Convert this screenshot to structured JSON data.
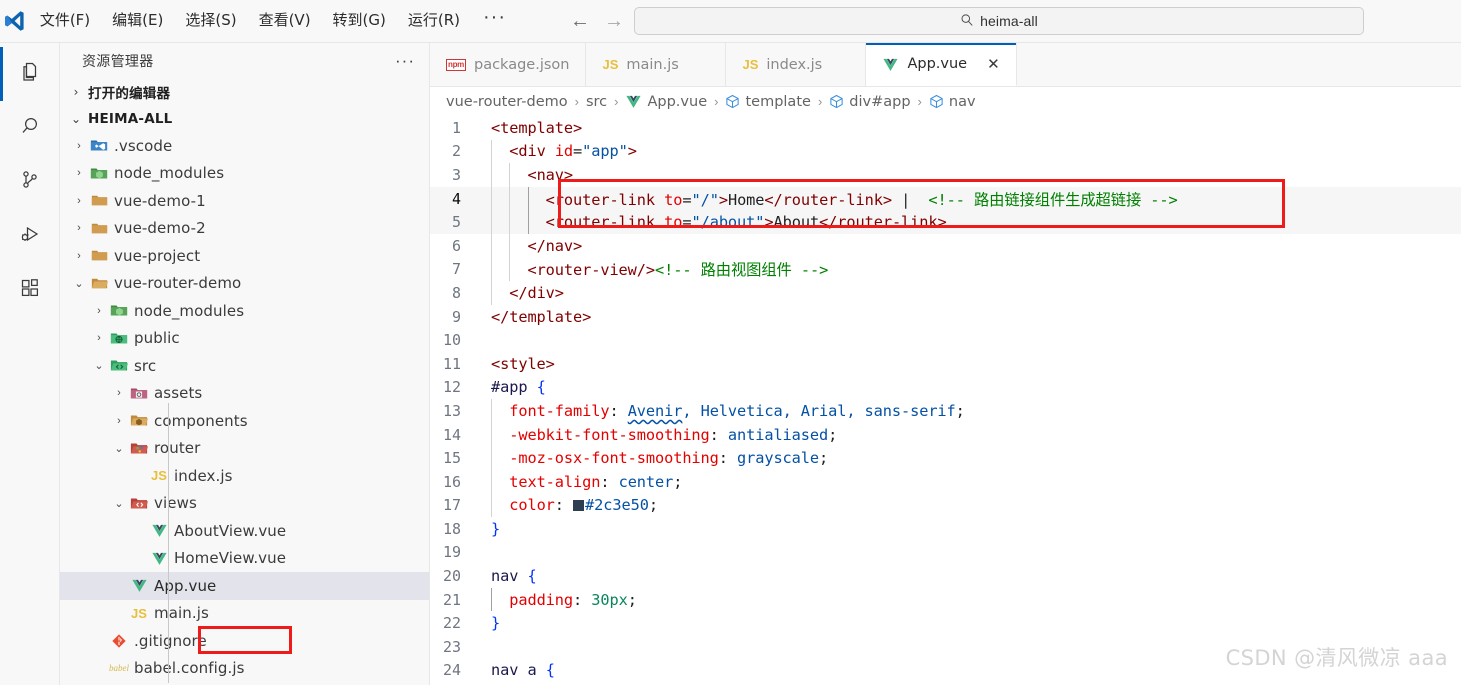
{
  "titlebar": {
    "logo_icon": "vscode-logo-icon",
    "menu": [
      {
        "label": "文件(F)"
      },
      {
        "label": "编辑(E)"
      },
      {
        "label": "选择(S)"
      },
      {
        "label": "查看(V)"
      },
      {
        "label": "转到(G)"
      },
      {
        "label": "运行(R)"
      }
    ],
    "more_label": "···",
    "back_label": "←",
    "forward_label": "→",
    "quick_open": {
      "value": "heima-all",
      "placeholder": "heima-all",
      "icon": "search-icon"
    }
  },
  "activitybar": {
    "items": [
      {
        "name": "explorer",
        "icon": "files-icon",
        "active": true
      },
      {
        "name": "search",
        "icon": "search-icon",
        "active": false
      },
      {
        "name": "source-control",
        "icon": "source-control-icon",
        "active": false
      },
      {
        "name": "run-debug",
        "icon": "run-and-debug-icon",
        "active": false
      },
      {
        "name": "extensions",
        "icon": "extensions-icon",
        "active": false
      }
    ],
    "active_indicator_color": "#005fb8"
  },
  "sidebar": {
    "title": "资源管理器",
    "more_label": "···",
    "sections": [
      {
        "label": "打开的编辑器",
        "expanded": false,
        "twisty": "›"
      },
      {
        "label": "HEIMA-ALL",
        "expanded": true,
        "twisty": "⌄"
      }
    ],
    "tree": [
      {
        "label": ".vscode",
        "depth": 1,
        "twisty": "›",
        "icon": "vscode-folder-icon",
        "selected": false
      },
      {
        "label": "node_modules",
        "depth": 1,
        "twisty": "›",
        "icon": "node-folder-icon",
        "selected": false
      },
      {
        "label": "vue-demo-1",
        "depth": 1,
        "twisty": "›",
        "icon": "folder-icon",
        "selected": false
      },
      {
        "label": "vue-demo-2",
        "depth": 1,
        "twisty": "›",
        "icon": "folder-icon",
        "selected": false
      },
      {
        "label": "vue-project",
        "depth": 1,
        "twisty": "›",
        "icon": "folder-icon",
        "selected": false
      },
      {
        "label": "vue-router-demo",
        "depth": 1,
        "twisty": "⌄",
        "icon": "folder-open-icon",
        "selected": false
      },
      {
        "label": "node_modules",
        "depth": 2,
        "twisty": "›",
        "icon": "node-folder-icon",
        "selected": false
      },
      {
        "label": "public",
        "depth": 2,
        "twisty": "›",
        "icon": "public-folder-icon",
        "selected": false
      },
      {
        "label": "src",
        "depth": 2,
        "twisty": "⌄",
        "icon": "src-folder-icon",
        "selected": false
      },
      {
        "label": "assets",
        "depth": 3,
        "twisty": "›",
        "icon": "assets-folder-icon",
        "selected": false
      },
      {
        "label": "components",
        "depth": 3,
        "twisty": "›",
        "icon": "components-folder-icon",
        "selected": false
      },
      {
        "label": "router",
        "depth": 3,
        "twisty": "⌄",
        "icon": "router-folder-icon",
        "selected": false
      },
      {
        "label": "index.js",
        "depth": 4,
        "twisty": "",
        "icon": "js-file-icon",
        "selected": false
      },
      {
        "label": "views",
        "depth": 3,
        "twisty": "⌄",
        "icon": "views-folder-icon",
        "selected": false
      },
      {
        "label": "AboutView.vue",
        "depth": 4,
        "twisty": "",
        "icon": "vue-file-icon",
        "selected": false
      },
      {
        "label": "HomeView.vue",
        "depth": 4,
        "twisty": "",
        "icon": "vue-file-icon",
        "selected": false
      },
      {
        "label": "App.vue",
        "depth": 3,
        "twisty": "",
        "icon": "vue-file-icon",
        "selected": true
      },
      {
        "label": "main.js",
        "depth": 3,
        "twisty": "",
        "icon": "js-file-icon",
        "selected": false
      },
      {
        "label": ".gitignore",
        "depth": 2,
        "twisty": "",
        "icon": "git-file-icon",
        "selected": false
      },
      {
        "label": "babel.config.js",
        "depth": 2,
        "twisty": "",
        "icon": "babel-file-icon",
        "selected": false
      }
    ]
  },
  "editor": {
    "tabs": [
      {
        "label": "package.json",
        "icon": "npm-file-icon",
        "active": false,
        "closable": false
      },
      {
        "label": "main.js",
        "icon": "js-file-icon",
        "active": false,
        "closable": false
      },
      {
        "label": "index.js",
        "icon": "js-file-icon",
        "active": false,
        "closable": false
      },
      {
        "label": "App.vue",
        "icon": "vue-file-icon",
        "active": true,
        "closable": true
      }
    ],
    "tab_close_label": "✕",
    "breadcrumb": [
      {
        "label": "vue-router-demo",
        "icon": ""
      },
      {
        "label": "src",
        "icon": ""
      },
      {
        "label": "App.vue",
        "icon": "vue-file-icon"
      },
      {
        "label": "template",
        "icon": "symbol-field-icon"
      },
      {
        "label": "div#app",
        "icon": "symbol-field-icon"
      },
      {
        "label": "nav",
        "icon": "symbol-field-icon"
      }
    ],
    "breadcrumb_separator": "›",
    "code_lines": [
      {
        "n": 1,
        "text": "<template>"
      },
      {
        "n": 2,
        "text": "  <div id=\"app\">"
      },
      {
        "n": 3,
        "text": "    <nav>"
      },
      {
        "n": 4,
        "text": "      <router-link to=\"/\">Home</router-link> |  <!-- 路由链接组件生成超链接 -->"
      },
      {
        "n": 5,
        "text": "      <router-link to=\"/about\">About</router-link>"
      },
      {
        "n": 6,
        "text": "    </nav>"
      },
      {
        "n": 7,
        "text": "    <router-view/><!-- 路由视图组件 -->"
      },
      {
        "n": 8,
        "text": "  </div>"
      },
      {
        "n": 9,
        "text": "</template>"
      },
      {
        "n": 10,
        "text": ""
      },
      {
        "n": 11,
        "text": "<style>"
      },
      {
        "n": 12,
        "text": "#app {"
      },
      {
        "n": 13,
        "text": "  font-family: Avenir, Helvetica, Arial, sans-serif;"
      },
      {
        "n": 14,
        "text": "  -webkit-font-smoothing: antialiased;"
      },
      {
        "n": 15,
        "text": "  -moz-osx-font-smoothing: grayscale;"
      },
      {
        "n": 16,
        "text": "  text-align: center;"
      },
      {
        "n": 17,
        "text": "  color: #2c3e50;"
      },
      {
        "n": 18,
        "text": "}"
      },
      {
        "n": 19,
        "text": ""
      },
      {
        "n": 20,
        "text": "nav {"
      },
      {
        "n": 21,
        "text": "  padding: 30px;"
      },
      {
        "n": 22,
        "text": "}"
      },
      {
        "n": 23,
        "text": ""
      },
      {
        "n": 24,
        "text": "nav a {"
      }
    ],
    "color_swatch_value": "#2c3e50",
    "cursor_line": 4,
    "annotation_color": "#ef1b1b"
  },
  "watermark": "CSDN @清风微凉 aaa",
  "theme": {
    "accent": "#005fb8",
    "chrome_bg": "#f8f8f8",
    "editor_bg": "#ffffff",
    "selected_row_bg": "#e3e3ec",
    "annotation_red": "#ef1b1b"
  }
}
